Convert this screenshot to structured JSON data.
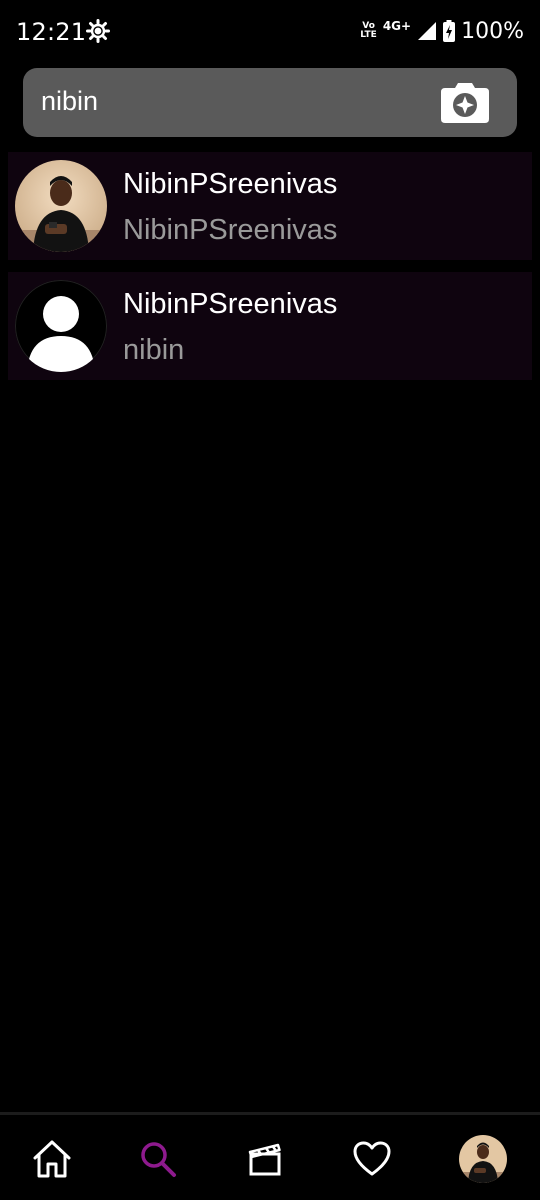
{
  "status_bar": {
    "time": "12:21",
    "volte_line1": "Vo",
    "volte_line2": "LTE",
    "network": "4G+",
    "battery": "100%"
  },
  "search": {
    "value": "nibin",
    "placeholder": ""
  },
  "results": [
    {
      "title": "NibinPSreenivas",
      "subtitle": "NibinPSreenivas",
      "avatar": "photo"
    },
    {
      "title": "NibinPSreenivas",
      "subtitle": "nibin",
      "avatar": "default-user-icon"
    }
  ],
  "bottom_nav": {
    "items": [
      "home-icon",
      "search-icon",
      "reels-icon",
      "heart-icon",
      "profile-avatar"
    ],
    "active": "search-icon",
    "active_color": "#8e1a8e"
  },
  "colors": {
    "background": "#000000",
    "search_bg": "#5a5a5a",
    "item_bg": "#0f040f",
    "subtitle": "#9a9a9a"
  }
}
